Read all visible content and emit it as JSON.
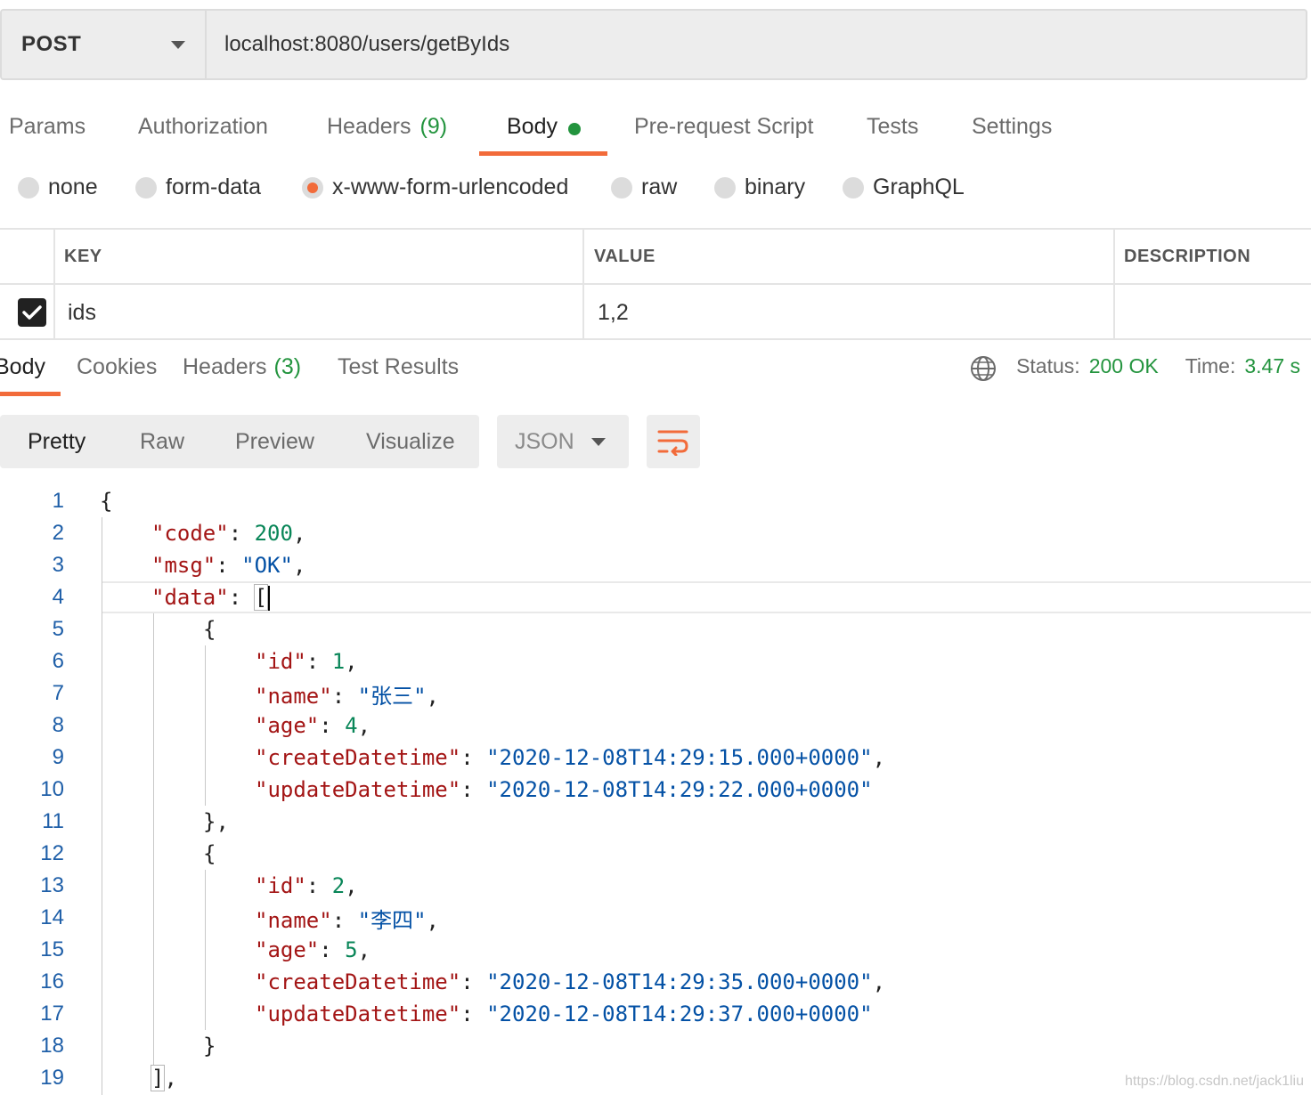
{
  "request": {
    "method": "POST",
    "url": "localhost:8080/users/getByIds"
  },
  "request_tabs": {
    "params": "Params",
    "authorization": "Authorization",
    "headers": "Headers",
    "headers_count": "(9)",
    "body": "Body",
    "prerequest": "Pre-request Script",
    "tests": "Tests",
    "settings": "Settings"
  },
  "body_modes": {
    "none": "none",
    "form_data": "form-data",
    "urlencoded": "x-www-form-urlencoded",
    "raw": "raw",
    "binary": "binary",
    "graphql": "GraphQL",
    "selected": "x-www-form-urlencoded"
  },
  "params_table": {
    "headers": {
      "key": "KEY",
      "value": "VALUE",
      "description": "DESCRIPTION"
    },
    "rows": [
      {
        "checked": true,
        "key": "ids",
        "value": "1,2",
        "description": ""
      }
    ]
  },
  "response_tabs": {
    "body": "Body",
    "cookies": "Cookies",
    "headers": "Headers",
    "headers_count": "(3)",
    "test_results": "Test Results"
  },
  "response_status": {
    "status_label": "Status:",
    "status_value": "200 OK",
    "time_label": "Time:",
    "time_value": "3.47 s"
  },
  "view_modes": {
    "pretty": "Pretty",
    "raw": "Raw",
    "preview": "Preview",
    "visualize": "Visualize",
    "format": "JSON"
  },
  "response_json": {
    "line_numbers": [
      "1",
      "2",
      "3",
      "4",
      "5",
      "6",
      "7",
      "8",
      "9",
      "10",
      "11",
      "12",
      "13",
      "14",
      "15",
      "16",
      "17",
      "18",
      "19"
    ],
    "code": 200,
    "msg": "OK",
    "users": [
      {
        "id": 1,
        "name": "张三",
        "age": 4,
        "createDatetime": "2020-12-08T14:29:15.000+0000",
        "updateDatetime": "2020-12-08T14:29:22.000+0000"
      },
      {
        "id": 2,
        "name": "李四",
        "age": 5,
        "createDatetime": "2020-12-08T14:29:35.000+0000",
        "updateDatetime": "2020-12-08T14:29:37.000+0000"
      }
    ]
  },
  "watermark": "https://blog.csdn.net/jack1liu",
  "colors": {
    "accent": "#f26b3a",
    "success": "#23943e",
    "json_key": "#a31515",
    "json_string": "#0451a5",
    "json_number": "#098658"
  },
  "icons": {
    "method_dropdown": "chevron-down-icon",
    "response_globe": "globe-icon",
    "wrap": "wrap-lines-icon",
    "format_dropdown": "chevron-down-icon"
  }
}
